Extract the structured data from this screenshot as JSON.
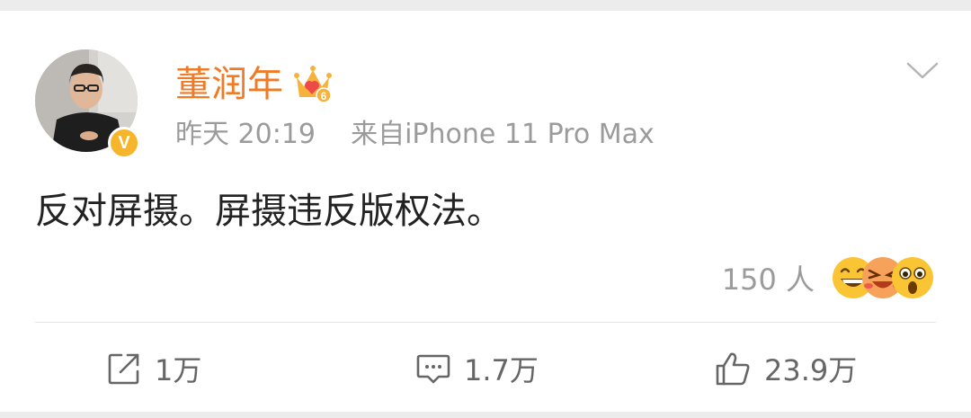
{
  "post": {
    "username": "董润年",
    "member_level_badge": "6",
    "timestamp": "昨天 20:19",
    "source": "来自iPhone 11 Pro Max",
    "text": "反对屏摄。屏摄违反版权法。",
    "reactions": {
      "count_label": "150 人",
      "emojis": [
        "grinning-emoji",
        "laughing-emoji",
        "surprised-emoji"
      ]
    }
  },
  "actions": {
    "repost": {
      "label": "1万",
      "icon": "share-icon"
    },
    "comment": {
      "label": "1.7万",
      "icon": "comment-icon"
    },
    "like": {
      "label": "23.9万",
      "icon": "thumbs-up-icon"
    }
  },
  "colors": {
    "username": "#f07a25",
    "meta": "#9b9b9b",
    "text": "#222222",
    "verified_badge": "#f6b52b",
    "action_label": "#666666"
  }
}
